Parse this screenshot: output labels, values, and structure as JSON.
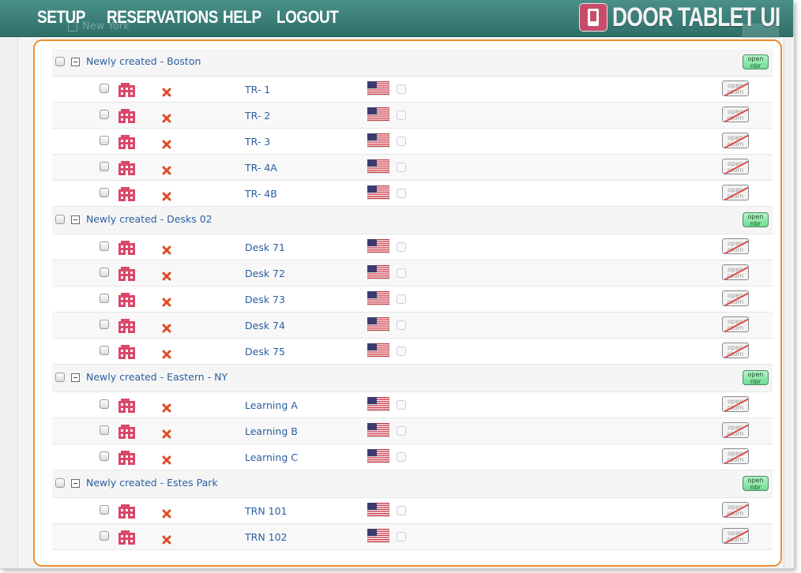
{
  "nav": {
    "items": [
      "SETUP",
      "RESERVATIONS",
      "HELP",
      "LOGOUT"
    ]
  },
  "logo": {
    "text": "DOOR TABLET UI"
  },
  "background": {
    "ghost_label": "New York"
  },
  "groups": [
    {
      "label": "Newly created - Boston",
      "badge": [
        "open",
        "nbr"
      ],
      "rooms": [
        "TR- 1",
        "TR- 2",
        "TR- 3",
        "TR- 4A",
        "TR- 4B"
      ]
    },
    {
      "label": "Newly created - Desks 02",
      "badge": [
        "open",
        "nbr"
      ],
      "rooms": [
        "Desk 71",
        "Desk 72",
        "Desk 73",
        "Desk 74",
        "Desk 75"
      ]
    },
    {
      "label": "Newly created - Eastern - NY",
      "badge": [
        "open",
        "nbr"
      ],
      "rooms": [
        "Learning A",
        "Learning B",
        "Learning C"
      ]
    },
    {
      "label": "Newly created - Estes Park",
      "badge": [
        "open",
        "nbr"
      ],
      "rooms": [
        "TRN 101",
        "TRN 102"
      ]
    }
  ],
  "room_button": [
    "open",
    "room"
  ],
  "icons": {
    "building": "building-icon",
    "remove": "remove-x-icon",
    "flag": "us-flag-icon"
  },
  "colors": {
    "header": "#3b7f78",
    "accent_border": "#ef8d2d",
    "link": "#2a5fa0",
    "building": "#d9486a",
    "badge_green": "#7fe3a0",
    "remove_red": "#e04a22"
  }
}
